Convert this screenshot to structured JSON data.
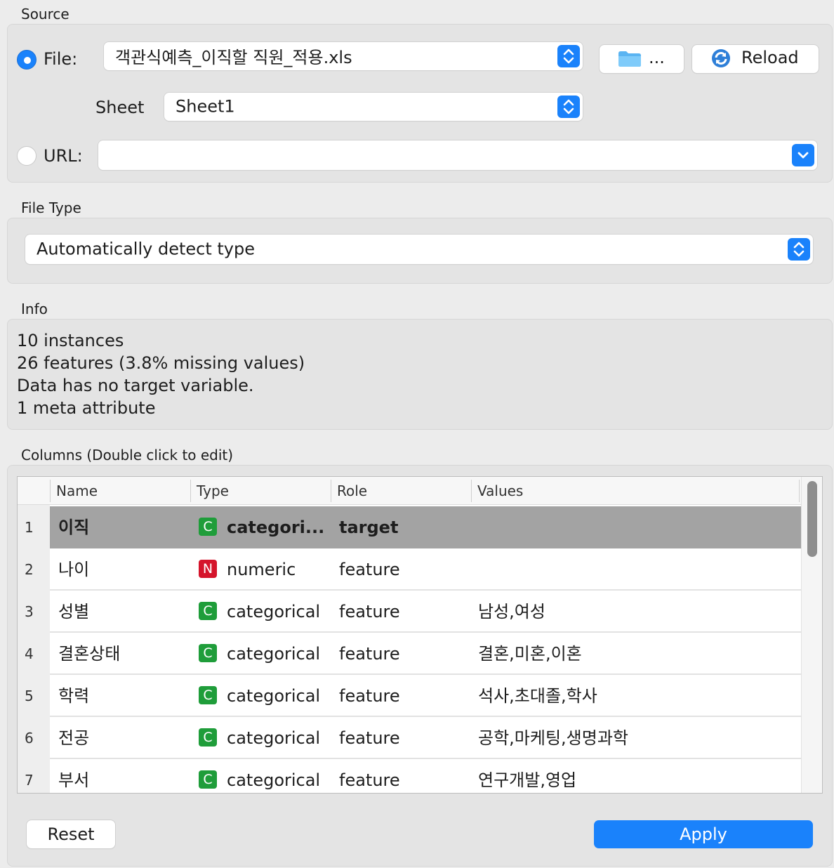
{
  "source": {
    "section_title": "Source",
    "file_label": "File:",
    "file_value": "객관식예측_이직할 직원_적용.xls",
    "browse_label": "...",
    "reload_label": "Reload",
    "sheet_label": "Sheet",
    "sheet_value": "Sheet1",
    "url_label": "URL:",
    "url_value": ""
  },
  "file_type": {
    "section_title": "File Type",
    "value": "Automatically detect type"
  },
  "info": {
    "section_title": "Info",
    "lines": [
      "10 instances",
      "26 features (3.8% missing values)",
      "Data has no target variable.",
      "1 meta attribute"
    ]
  },
  "columns": {
    "section_title": "Columns (Double click to edit)",
    "headers": [
      "Name",
      "Type",
      "Role",
      "Values"
    ],
    "rows": [
      {
        "num": "1",
        "name": "이직",
        "badge": "C",
        "type": "categori...",
        "role": "target",
        "values": ""
      },
      {
        "num": "2",
        "name": "나이",
        "badge": "N",
        "type": "numeric",
        "role": "feature",
        "values": ""
      },
      {
        "num": "3",
        "name": "성별",
        "badge": "C",
        "type": "categorical",
        "role": "feature",
        "values": "남성,여성"
      },
      {
        "num": "4",
        "name": "결혼상태",
        "badge": "C",
        "type": "categorical",
        "role": "feature",
        "values": "결혼,미혼,이혼"
      },
      {
        "num": "5",
        "name": "학력",
        "badge": "C",
        "type": "categorical",
        "role": "feature",
        "values": "석사,초대졸,학사"
      },
      {
        "num": "6",
        "name": "전공",
        "badge": "C",
        "type": "categorical",
        "role": "feature",
        "values": "공학,마케팅,생명과학"
      },
      {
        "num": "7",
        "name": "부서",
        "badge": "C",
        "type": "categorical",
        "role": "feature",
        "values": "연구개발,영업"
      }
    ]
  },
  "buttons": {
    "reset_label": "Reset",
    "apply_label": "Apply"
  },
  "colors": {
    "accent": "#1a82fb",
    "badge_categorical": "#1f9d3a",
    "badge_numeric": "#d5142b",
    "selected_row": "#a3a3a3"
  }
}
